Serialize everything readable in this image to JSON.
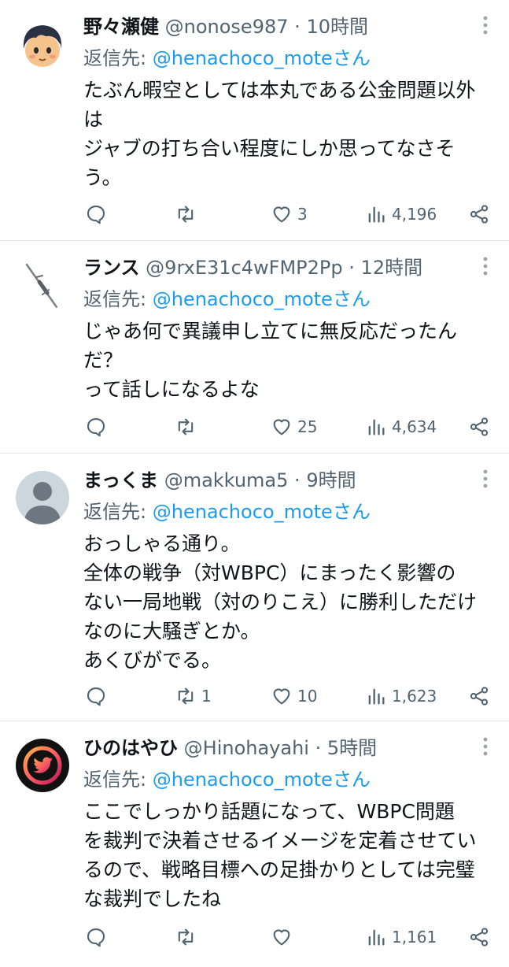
{
  "tweets": [
    {
      "name": "野々瀬健",
      "handle": "@nonose987",
      "sep": "·",
      "time": "10時間",
      "reply_prefix": "返信先: ",
      "reply_to": "@henachoco_moteさん",
      "lines": [
        "たぶん暇空としては本丸である公金問題以外",
        "は",
        "ジャブの打ち合い程度にしか思ってなさそ",
        "う。"
      ],
      "replies": "",
      "retweets": "",
      "likes": "3",
      "views": "4,196",
      "avatar": "cartoon-face-avatar"
    },
    {
      "name": "ランス",
      "handle": "@9rxE31c4wFMP2Pp",
      "sep": "·",
      "time": "12時間",
      "reply_prefix": "返信先: ",
      "reply_to": "@henachoco_moteさん",
      "lines": [
        "じゃあ何で異議申し立てに無反応だったん",
        "だ？",
        "って話しになるよな"
      ],
      "replies": "",
      "retweets": "",
      "likes": "25",
      "views": "4,634",
      "avatar": "lance-avatar"
    },
    {
      "name": "まっくま",
      "handle": "@makkuma5",
      "sep": "·",
      "time": "9時間",
      "reply_prefix": "返信先: ",
      "reply_to": "@henachoco_moteさん",
      "lines": [
        "おっしゃる通り。",
        "全体の戦争（対WBPC）にまったく影響の",
        "ない一局地戦（対のりこえ）に勝利しただけ",
        "なのに大騒ぎとか。",
        "あくびがでる。"
      ],
      "replies": "",
      "retweets": "1",
      "likes": "10",
      "views": "1,623",
      "avatar": "default-avatar"
    },
    {
      "name": "ひのはやひ",
      "handle": "@Hinohayahi",
      "sep": "·",
      "time": "5時間",
      "reply_prefix": "返信先: ",
      "reply_to": "@henachoco_moteさん",
      "lines": [
        "ここでしっかり話題になって、WBPC問題",
        "を裁判で決着させるイメージを定着させてい",
        "るので、戦略目標への足掛かりとしては完璧",
        "な裁判でしたね"
      ],
      "replies": "",
      "retweets": "",
      "likes": "",
      "views": "1,161",
      "avatar": "bird-ring-avatar"
    }
  ],
  "colors": {
    "text": "#0f1419",
    "secondary": "#536471",
    "link": "#1d9bf0",
    "divider": "#e6e9ec"
  },
  "icons": [
    "reply-icon",
    "retweet-icon",
    "like-icon",
    "views-icon",
    "share-icon",
    "more-icon"
  ]
}
